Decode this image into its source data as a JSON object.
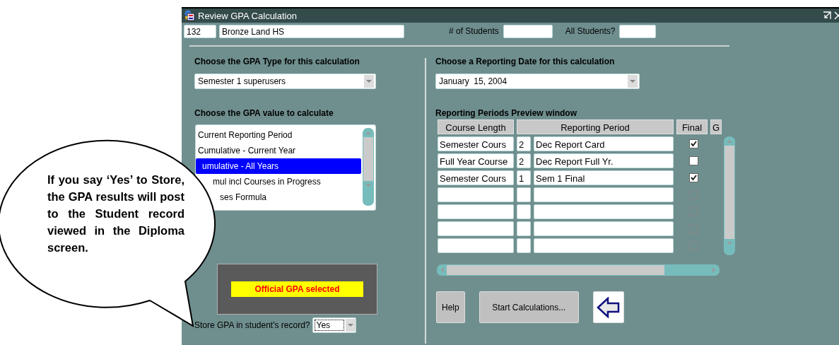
{
  "window": {
    "title": "Review GPA Calculation"
  },
  "header": {
    "school_code": "132",
    "school_name": "Bronze Land HS",
    "students_label": "# of Students",
    "all_students_label": "All Students?"
  },
  "gpa_type": {
    "heading": "Choose the GPA Type for this calculation",
    "value": "Semester 1 superusers"
  },
  "gpa_value": {
    "heading": "Choose the GPA value to calculate",
    "items": [
      {
        "label": "Current Reporting Period",
        "selected": false
      },
      {
        "label": "Cumulative - Current Year",
        "selected": false
      },
      {
        "label": "umulative - All Years",
        "selected": true
      },
      {
        "label": "mul incl Courses in Progress",
        "selected": false
      },
      {
        "label": "ses Formula",
        "selected": false
      }
    ]
  },
  "official_badge": "Official GPA selected",
  "store": {
    "label": "Store GPA in student's record?",
    "value": "Yes"
  },
  "reporting_date": {
    "heading": "Choose a Reporting Date for this calculation",
    "value": "January  15, 2004"
  },
  "preview": {
    "heading": "Reporting Periods Preview window",
    "columns": [
      "Course Length",
      "Reporting Period",
      "Final",
      "G"
    ],
    "rows": [
      {
        "course_length": "Semester Cours",
        "period_no": "2",
        "period": "Dec Report Card",
        "final": true,
        "disabled": false
      },
      {
        "course_length": "Full Year Course",
        "period_no": "2",
        "period": "Dec Report Full Yr.",
        "final": false,
        "disabled": false
      },
      {
        "course_length": "Semester Cours",
        "period_no": "1",
        "period": "Sem 1 Final",
        "final": true,
        "disabled": false
      },
      {
        "final": false,
        "disabled": true
      },
      {
        "final": false,
        "disabled": true
      },
      {
        "final": false,
        "disabled": true
      },
      {
        "final": false,
        "disabled": true
      }
    ]
  },
  "buttons": [
    {
      "label": "Help"
    },
    {
      "label": "Start Calculations..."
    }
  ],
  "callout": "If you say ‘Yes’ to Store, the GPA results will post to the Student record viewed in the Diploma screen."
}
